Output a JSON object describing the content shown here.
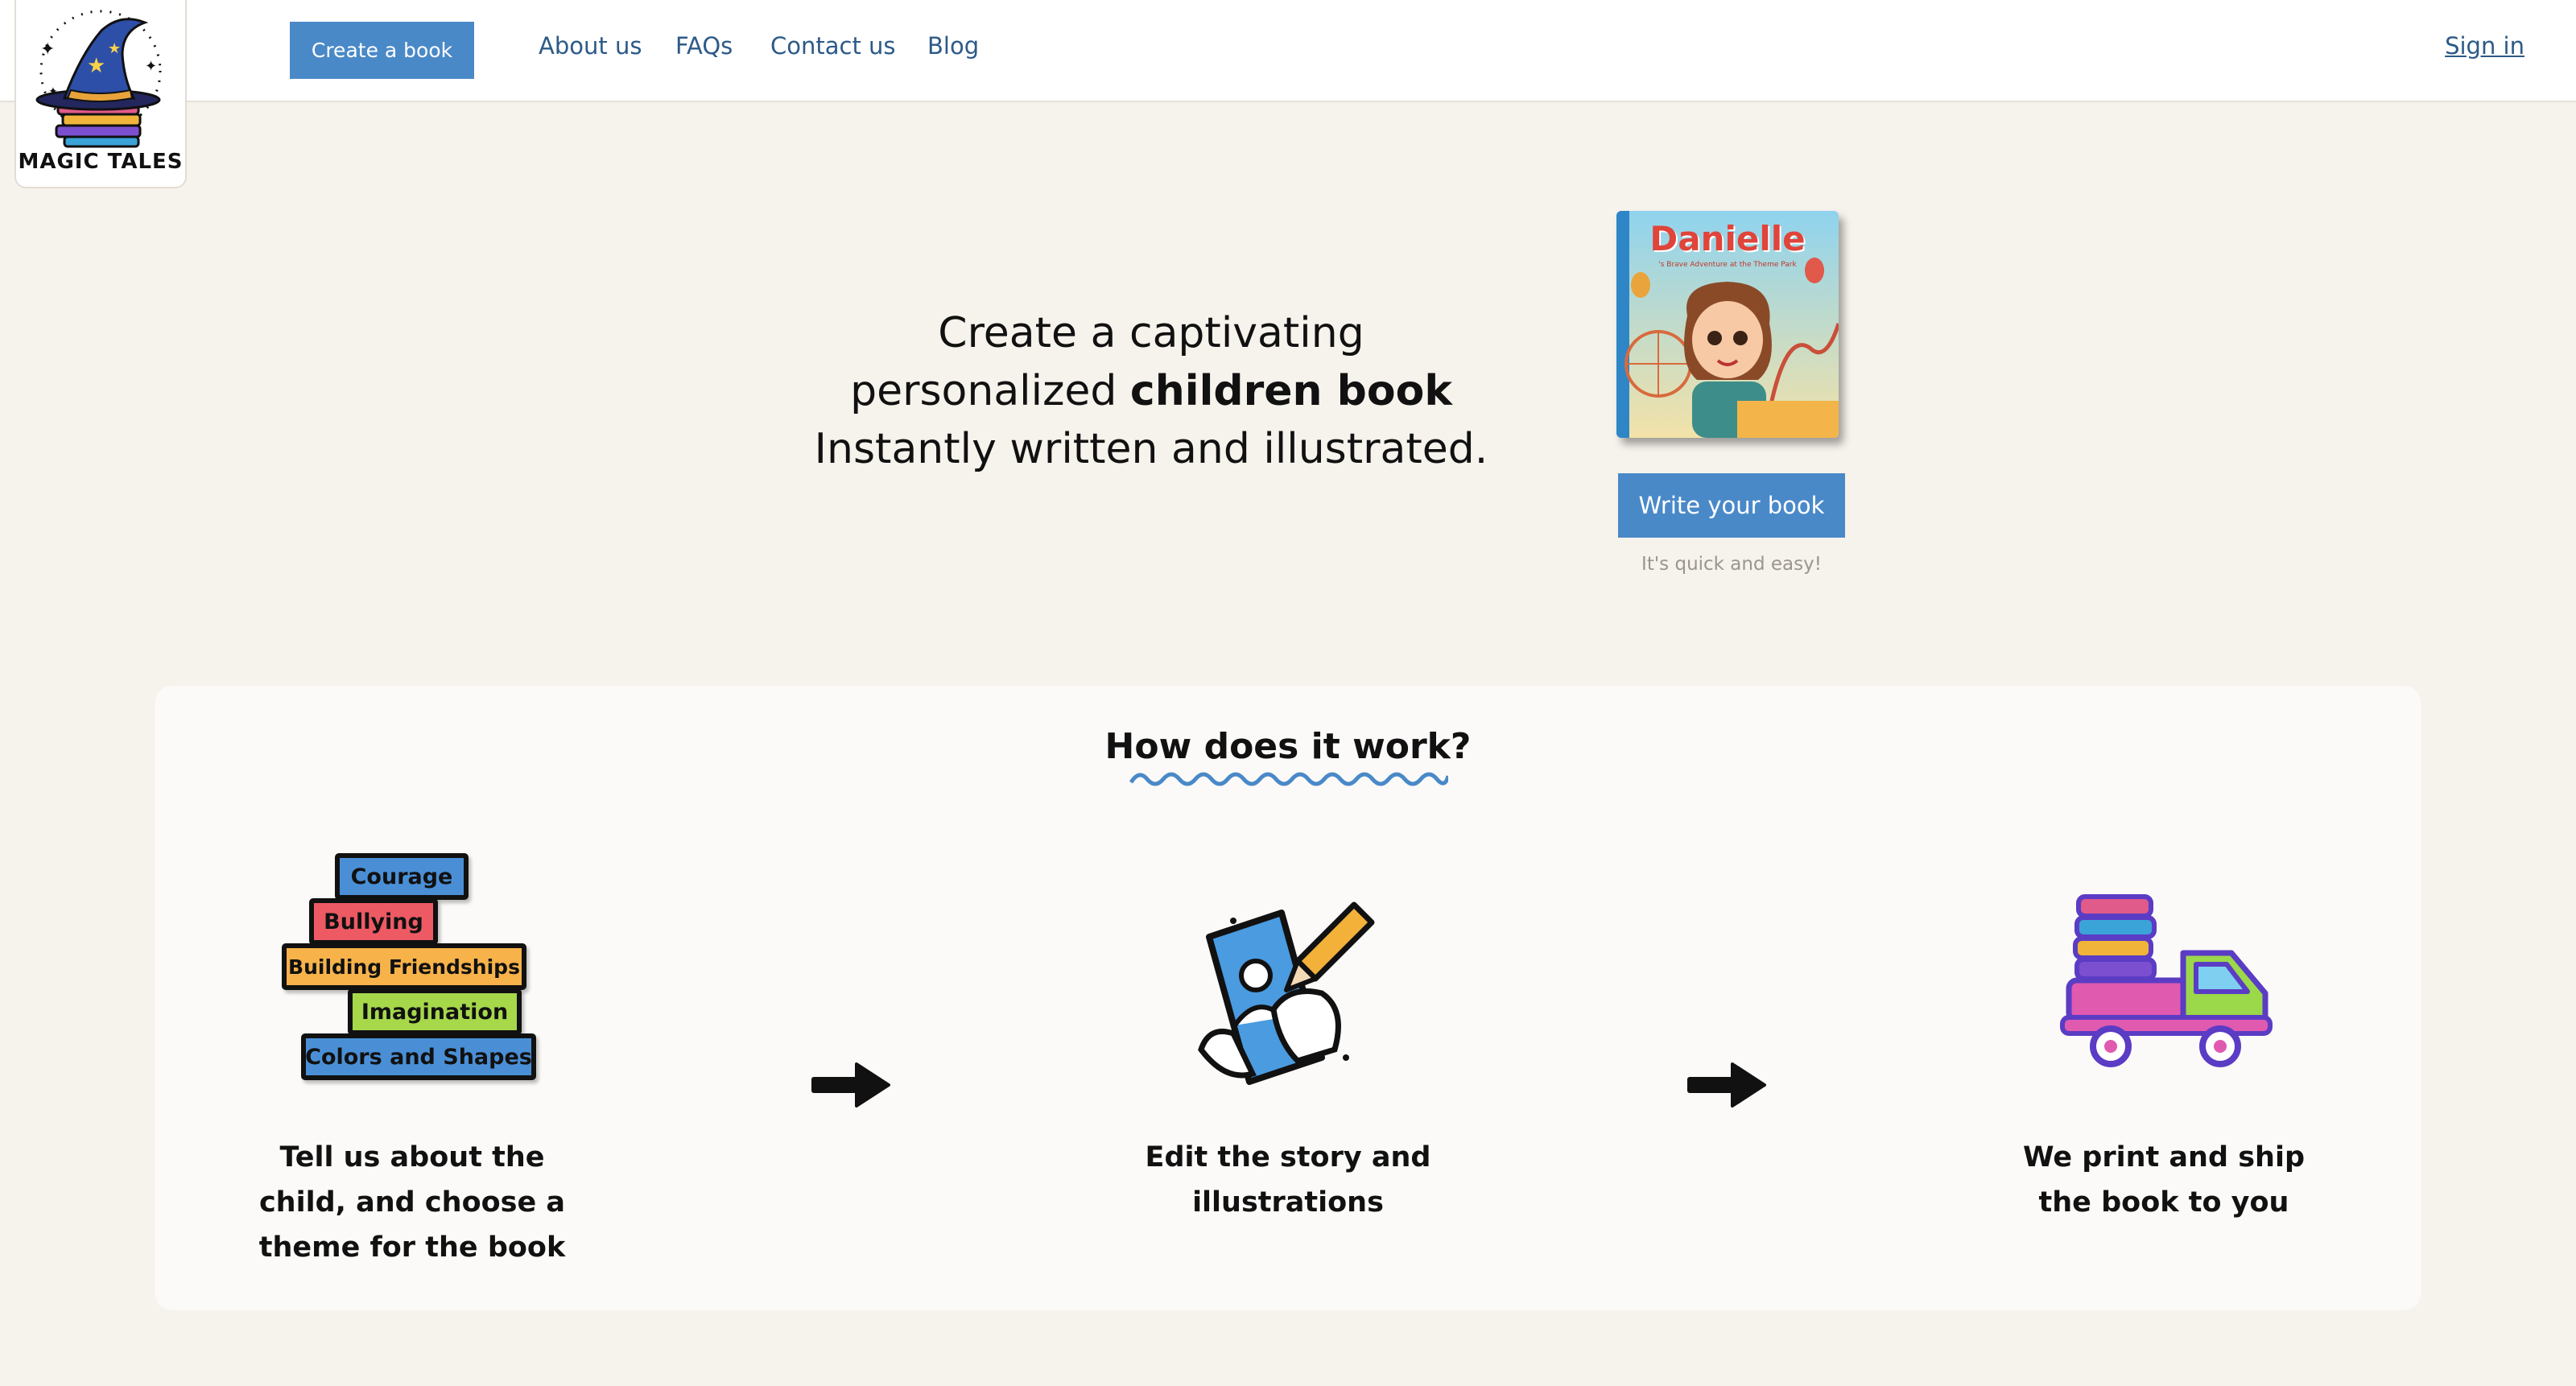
{
  "brand": {
    "name": "MAGIC TALES"
  },
  "header": {
    "create_button": "Create a book",
    "nav": [
      "About us",
      "FAQs",
      "Contact us",
      "Blog"
    ],
    "sign_in": "Sign in"
  },
  "hero": {
    "line1": "Create a captivating",
    "line2_prefix": "personalized ",
    "line2_bold": "children book",
    "line3": "Instantly written and illustrated.",
    "book_title": "Danielle",
    "book_subtitle": "'s Brave Adventure at the Theme Park",
    "write_button": "Write your book",
    "subtext": "It's quick and easy!"
  },
  "how": {
    "title": "How does it work?",
    "themes": [
      "Courage",
      "Bullying",
      "Building Friendships",
      "Imagination",
      "Colors and Shapes"
    ],
    "theme_colors": [
      "#4a8fd6",
      "#ee5a64",
      "#f7b24a",
      "#a6d84a",
      "#4a8fd6"
    ],
    "steps": [
      {
        "icon": "theme-blocks-icon",
        "text": [
          "Tell us about the",
          "child, and choose a",
          "theme for the book"
        ]
      },
      {
        "icon": "pencil-edit-icon",
        "text": [
          "Edit the story and",
          "illustrations"
        ]
      },
      {
        "icon": "delivery-truck-icon",
        "text": [
          "We print and ship",
          "the book to you"
        ]
      }
    ]
  },
  "colors": {
    "accent": "#4a89c8",
    "link": "#2d5a88",
    "background": "#f6f2ec"
  }
}
